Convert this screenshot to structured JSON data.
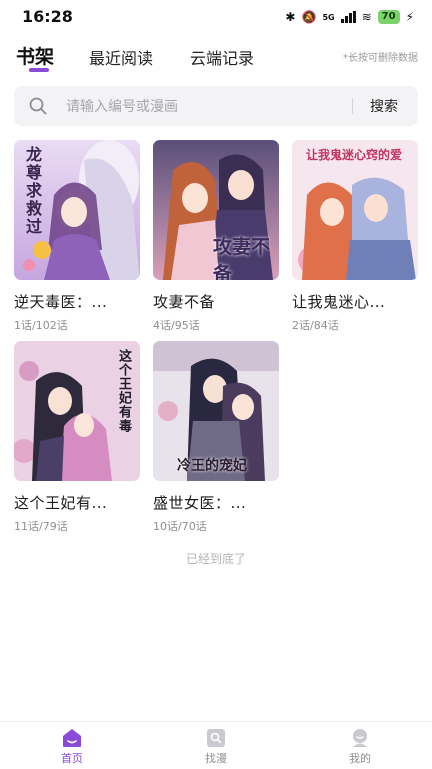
{
  "status_bar": {
    "time": "16:28",
    "battery": "70",
    "network": "5G"
  },
  "tabs": [
    {
      "label": "书架"
    },
    {
      "label": "最近阅读"
    },
    {
      "label": "云端记录"
    }
  ],
  "hint": "*长按可删除数据",
  "search": {
    "placeholder": "请输入编号或漫画",
    "button_label": "搜索"
  },
  "books": [
    {
      "title": "逆天毒医：...",
      "progress": "1话/102话",
      "cover_text": "龙尊求救过"
    },
    {
      "title": "攻妻不备",
      "progress": "4话/95话",
      "cover_text": "攻妻不备"
    },
    {
      "title": "让我鬼迷心...",
      "progress": "2话/84话",
      "cover_text": "让我鬼迷心窍的爱"
    },
    {
      "title": "这个王妃有...",
      "progress": "11话/79话",
      "cover_text": "这个王妃有毒"
    },
    {
      "title": "盛世女医：...",
      "progress": "10话/70话",
      "cover_text": "冷王的宠妃"
    }
  ],
  "end_text": "已经到底了",
  "bottom_nav": [
    {
      "label": "首页",
      "icon": "home-icon"
    },
    {
      "label": "找漫",
      "icon": "find-icon"
    },
    {
      "label": "我的",
      "icon": "profile-icon"
    }
  ],
  "colors": {
    "accent": "#8a4bd8",
    "muted": "#8e8e8e",
    "search_bg": "#f3f3f5"
  }
}
